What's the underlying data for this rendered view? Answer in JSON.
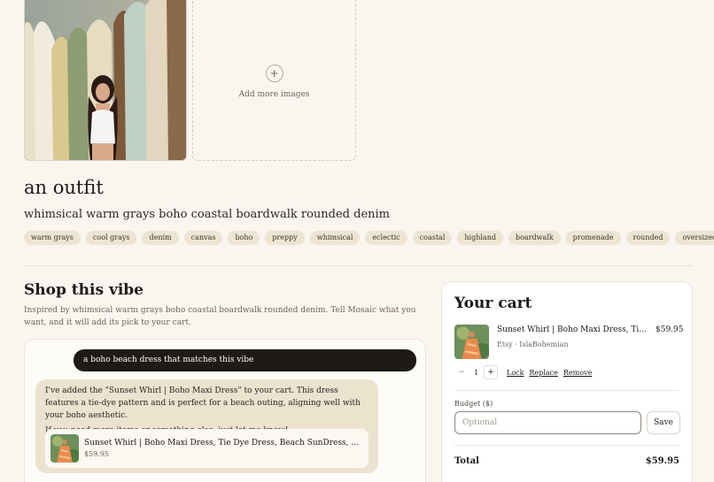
{
  "gallery": {
    "add_more_label": "Add more images",
    "plus_glyph": "+"
  },
  "outfit": {
    "title": "an outfit",
    "subtitle": "whimsical warm grays boho coastal boardwalk rounded denim",
    "tags": [
      "warm grays",
      "cool grays",
      "denim",
      "canvas",
      "boho",
      "preppy",
      "whimsical",
      "eclectic",
      "coastal",
      "highland",
      "boardwalk",
      "promenade",
      "rounded",
      "oversized"
    ]
  },
  "shop": {
    "title": "Shop this vibe",
    "description": "Inspired by whimsical warm grays boho coastal boardwalk rounded denim. Tell Mosaic what you want, and it will add its pick to your cart."
  },
  "chat": {
    "user_message": "a boho beach dress that matches this vibe",
    "bot_paragraph_1": "I've added the \"Sunset Whirl | Boho Maxi Dress\" to your cart. This dress features a tie-dye pattern and is perfect for a beach outing, aligning well with your boho aesthetic.",
    "bot_paragraph_2": "If you need more items or something else, just let me know!",
    "product": {
      "name": "Sunset Whirl | Boho Maxi Dress, Tie Dye Dress, Beach SunDress, Summer Dress",
      "price": "$59.95"
    }
  },
  "cart": {
    "title": "Your cart",
    "item": {
      "name": "Sunset Whirl | Boho Maxi Dress, Tie Dye Dress",
      "price": "$59.95",
      "seller": "Etsy · IslaBohemian",
      "quantity": "1"
    },
    "minus_glyph": "−",
    "plus_glyph": "+",
    "lock_label": "Lock",
    "replace_label": "Replace",
    "remove_label": "Remove",
    "budget_label": "Budget ($)",
    "budget_placeholder": "Optional",
    "save_label": "Save",
    "total_label": "Total",
    "total_value": "$59.95"
  },
  "colors": {
    "background": "#faf5ef",
    "tag_bg": "#ede4d2",
    "user_bubble": "#1d1a17",
    "bot_bubble": "#ece3cf"
  }
}
